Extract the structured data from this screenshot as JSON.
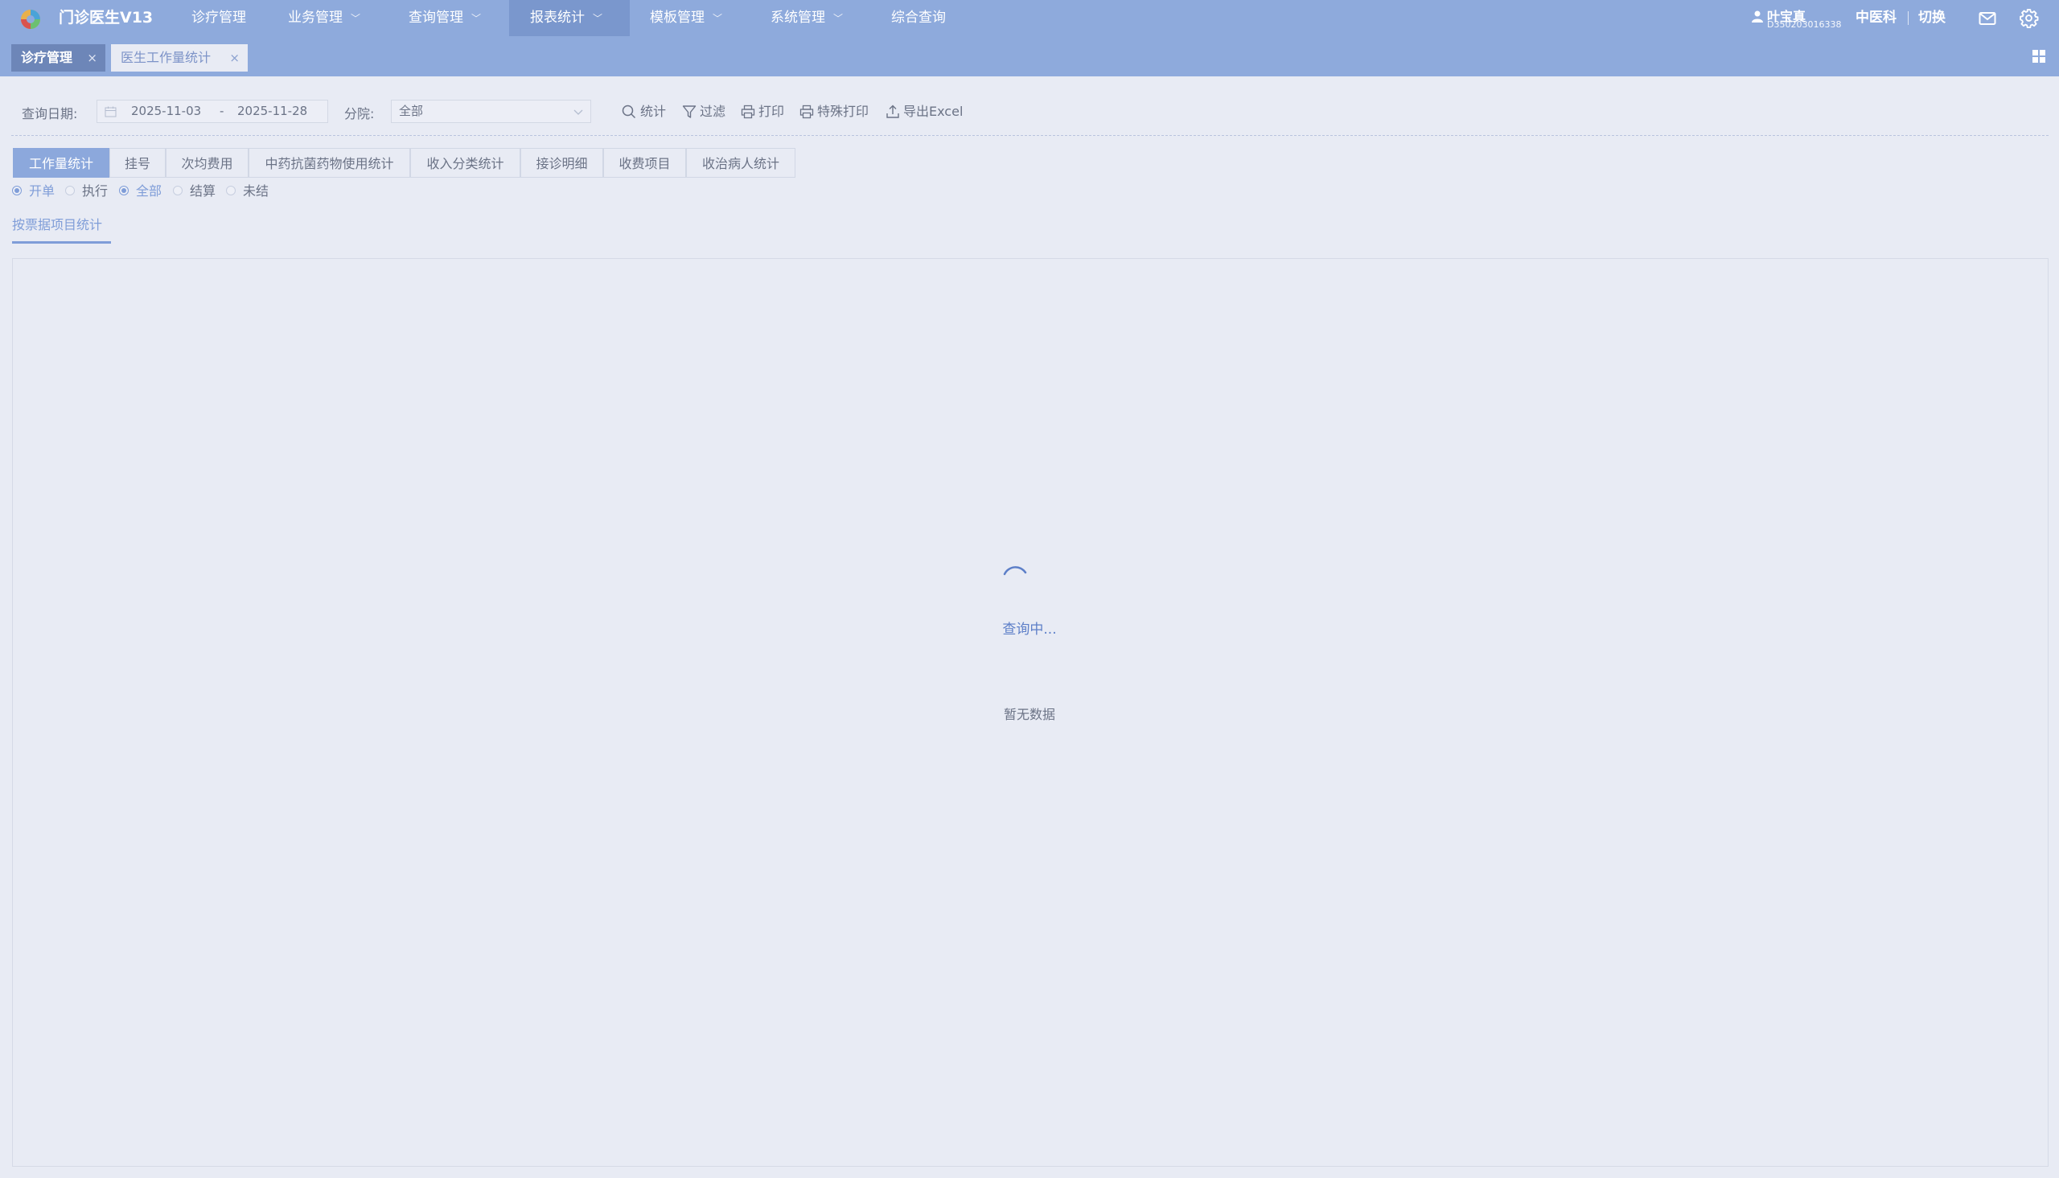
{
  "app": {
    "title": "门诊医生V13",
    "logo_icon": "app-logo-icon"
  },
  "nav": {
    "items": [
      {
        "label": "诊疗管理",
        "has_dropdown": false,
        "active": false
      },
      {
        "label": "业务管理",
        "has_dropdown": true,
        "active": false
      },
      {
        "label": "查询管理",
        "has_dropdown": true,
        "active": false
      },
      {
        "label": "报表统计",
        "has_dropdown": true,
        "active": true
      },
      {
        "label": "模板管理",
        "has_dropdown": true,
        "active": false
      },
      {
        "label": "系统管理",
        "has_dropdown": true,
        "active": false
      },
      {
        "label": "综合查询",
        "has_dropdown": false,
        "active": false
      }
    ]
  },
  "user": {
    "name": "叶宝真",
    "id": "D350203016338",
    "department": "中医科",
    "switch_label": "切换"
  },
  "page_tabs": [
    {
      "label": "诊疗管理",
      "close": "×"
    },
    {
      "label": "医生工作量统计",
      "close": "×"
    }
  ],
  "query": {
    "date_label": "查询日期:",
    "start_date": "2025-11-03",
    "separator": "-",
    "end_date": "2025-11-28",
    "branch_label": "分院:",
    "branch_value": "全部"
  },
  "toolbar": {
    "stat_label": "统计",
    "filter_label": "过滤",
    "print_label": "打印",
    "special_print_label": "特殊打印",
    "export_label": "导出Excel"
  },
  "report_tabs": [
    {
      "label": "工作量统计",
      "active": true
    },
    {
      "label": "挂号",
      "active": false
    },
    {
      "label": "次均费用",
      "active": false
    },
    {
      "label": "中药抗菌药物使用统计",
      "active": false
    },
    {
      "label": "收入分类统计",
      "active": false
    },
    {
      "label": "接诊明细",
      "active": false
    },
    {
      "label": "收费项目",
      "active": false
    },
    {
      "label": "收治病人统计",
      "active": false
    }
  ],
  "radio_group_1": [
    {
      "label": "开单",
      "checked": true
    },
    {
      "label": "执行",
      "checked": false
    }
  ],
  "radio_group_2": [
    {
      "label": "全部",
      "checked": true
    },
    {
      "label": "结算",
      "checked": false
    },
    {
      "label": "未结",
      "checked": false
    }
  ],
  "sub_tab": {
    "label": "按票据项目统计"
  },
  "panel": {
    "loading_text": "查询中...",
    "empty_text": "暂无数据"
  },
  "colors": {
    "nav_bg": "#8eaadc",
    "active_tab": "#8ca8dc",
    "accent": "#7f9dd8",
    "page_bg": "#e8ebf4"
  }
}
